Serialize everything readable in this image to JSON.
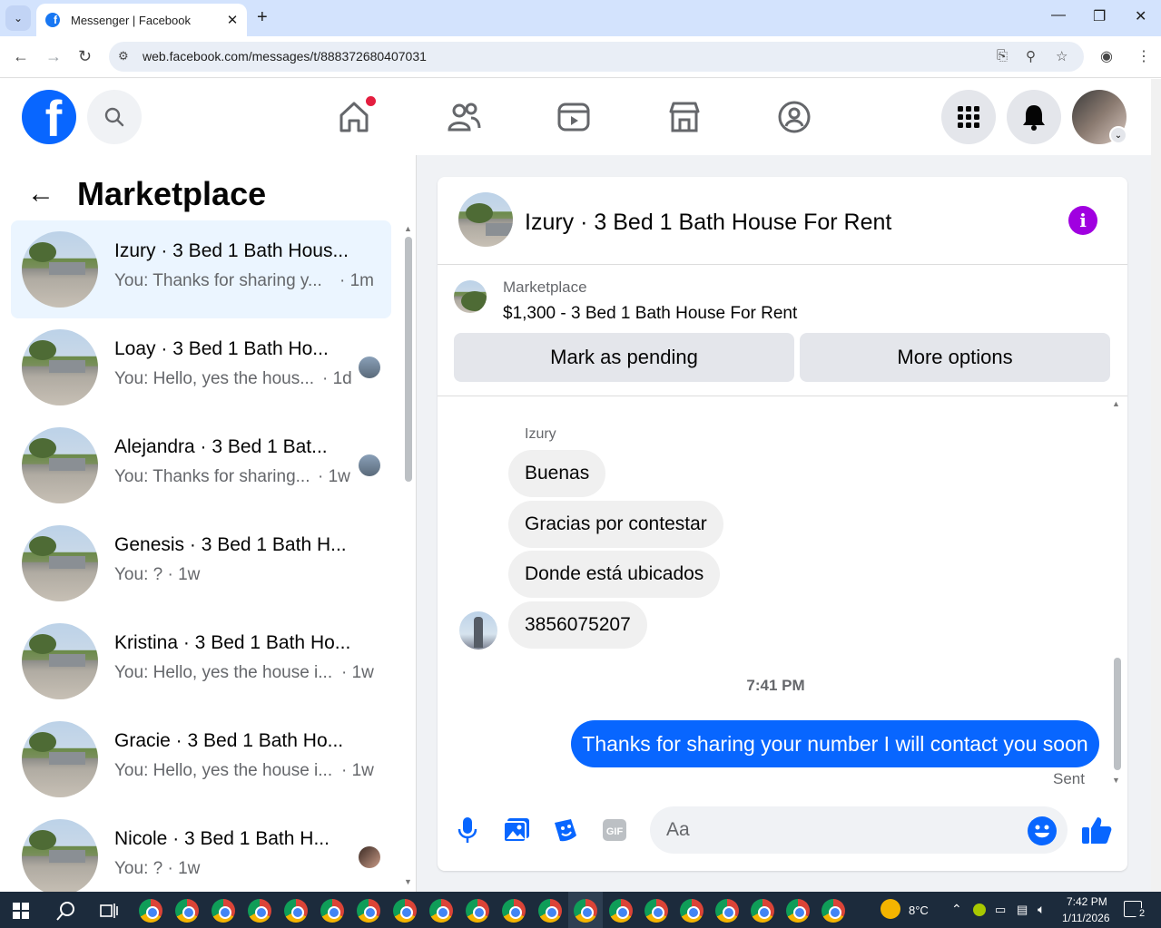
{
  "browser": {
    "tab_title": "Messenger | Facebook",
    "url": "web.facebook.com/messages/t/888372680407031",
    "new_tab": "+",
    "minimize": "—",
    "restore": "❐",
    "close": "✕"
  },
  "left": {
    "title": "Marketplace",
    "conversations": [
      {
        "name": "Izury · 3 Bed 1 Bath Hous...",
        "preview": "You: Thanks for sharing y...",
        "time": "· 1m",
        "active": true
      },
      {
        "name": "Loay · 3 Bed 1 Bath Ho...",
        "preview": "You: Hello, yes the hous...",
        "time": "· 1d"
      },
      {
        "name": "Alejandra · 3 Bed 1 Bat...",
        "preview": "You: Thanks for sharing...",
        "time": "· 1w"
      },
      {
        "name": "Genesis · 3 Bed 1 Bath H...",
        "preview": "You: ? · 1w",
        "time": ""
      },
      {
        "name": "Kristina · 3 Bed 1 Bath Ho...",
        "preview": "You: Hello, yes the house i...",
        "time": "· 1w"
      },
      {
        "name": "Gracie · 3 Bed 1 Bath Ho...",
        "preview": "You: Hello, yes the house i...",
        "time": "· 1w"
      },
      {
        "name": "Nicole · 3 Bed 1 Bath H...",
        "preview": "You: ? · 1w",
        "time": ""
      }
    ]
  },
  "chat": {
    "title": "Izury · 3 Bed 1 Bath House For Rent",
    "marketplace_label": "Marketplace",
    "listing": "$1,300 - 3 Bed 1 Bath House For Rent",
    "btn_pending": "Mark as pending",
    "btn_more": "More options",
    "sender": "Izury",
    "incoming": [
      "Buenas",
      "Gracias por contestar",
      "Donde está ubicados",
      "3856075207"
    ],
    "timestamp": "7:41 PM",
    "outgoing": "Thanks for sharing your number I will contact you soon",
    "status": "Sent",
    "composer_placeholder": "Aa"
  },
  "taskbar": {
    "weather": "8°C",
    "time": "7:42 PM",
    "date": "1/11/2026",
    "notifications": "2"
  },
  "colors": {
    "brand_blue": "#0866ff",
    "active_row": "#ebf5ff",
    "info_purple": "#a000e0",
    "notif_red": "#e41e3f"
  }
}
